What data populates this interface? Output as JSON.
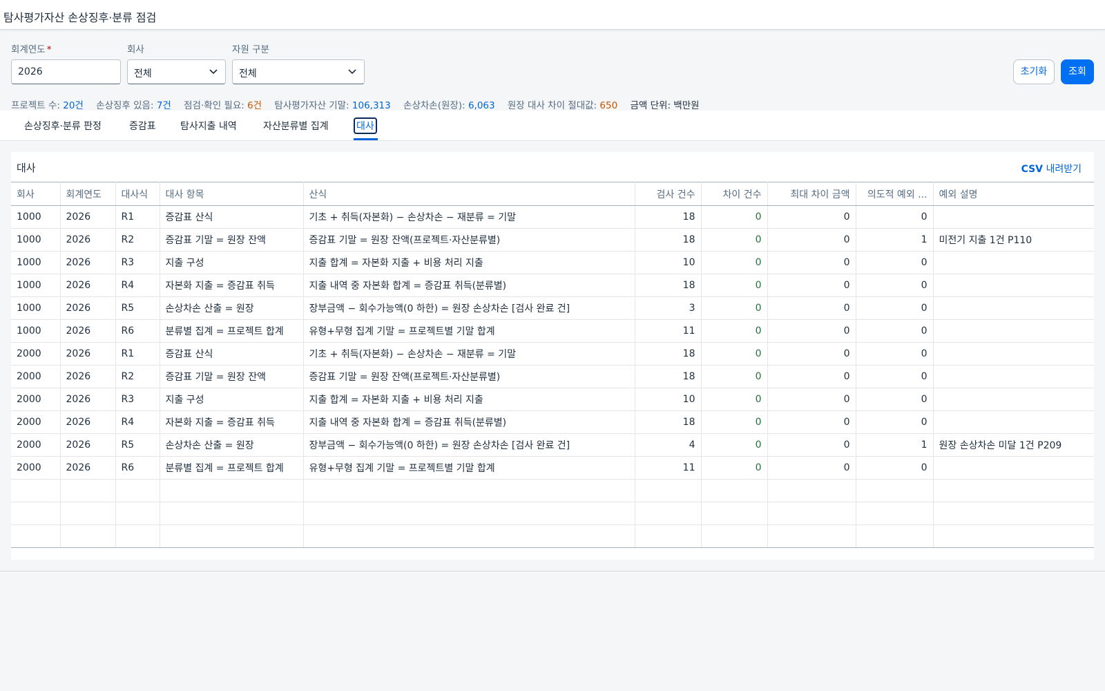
{
  "app": {
    "title": "탐사평가자산 손상징후·분류 점검"
  },
  "filters": {
    "fiscal_year": {
      "label": "회계연도",
      "required_mark": "*",
      "value": "2026"
    },
    "company": {
      "label": "회사",
      "value": "전체"
    },
    "resource_type": {
      "label": "자원 구분",
      "value": "전체"
    },
    "reset_label": "초기화",
    "search_label": "조회"
  },
  "summary": {
    "projects_label": "프로젝트 수:",
    "projects_value": "20건",
    "impairment_label": "손상징후 있음:",
    "impairment_value": "7건",
    "check_label": "점검·확인 필요:",
    "check_value": "6건",
    "ending_label": "탐사평가자산 기말:",
    "ending_value": "106,313",
    "loss_label": "손상차손(원장):",
    "loss_value": "6,063",
    "diff_label": "원장 대사 차이 절대값:",
    "diff_value": "650",
    "unit_label": "금액 단위: 백만원"
  },
  "tabs": [
    {
      "label": "손상징후·분류 판정"
    },
    {
      "label": "증감표"
    },
    {
      "label": "탐사지출 내역"
    },
    {
      "label": "자산분류별 집계"
    },
    {
      "label": "대사"
    }
  ],
  "panel": {
    "title": "대사",
    "csv_prefix": "CSV",
    "csv_suffix": " 내려받기"
  },
  "table": {
    "headers": [
      "회사",
      "회계연도",
      "대사식",
      "대사 항목",
      "산식",
      "검사 건수",
      "차이 건수",
      "최대 차이 금액",
      "의도적 예외 ...",
      "예외 설명"
    ],
    "rows": [
      [
        "1000",
        "2026",
        "R1",
        "증감표 산식",
        "기초 + 취득(자본화) − 손상차손 − 재분류 = 기말",
        "18",
        "0",
        "0",
        "0",
        ""
      ],
      [
        "1000",
        "2026",
        "R2",
        "증감표 기말 = 원장 잔액",
        "증감표 기말 = 원장 잔액(프로젝트·자산분류별)",
        "18",
        "0",
        "0",
        "1",
        "미전기 지출 1건 P110"
      ],
      [
        "1000",
        "2026",
        "R3",
        "지출 구성",
        "지출 합계 = 자본화 지출 + 비용 처리 지출",
        "10",
        "0",
        "0",
        "0",
        ""
      ],
      [
        "1000",
        "2026",
        "R4",
        "자본화 지출 = 증감표 취득",
        "지출 내역 중 자본화 합계 = 증감표 취득(분류별)",
        "18",
        "0",
        "0",
        "0",
        ""
      ],
      [
        "1000",
        "2026",
        "R5",
        "손상차손 산출 = 원장",
        "장부금액 − 회수가능액(0 하한) = 원장 손상차손 [검사 완료 건]",
        "3",
        "0",
        "0",
        "0",
        ""
      ],
      [
        "1000",
        "2026",
        "R6",
        "분류별 집계 = 프로젝트 합계",
        "유형+무형 집계 기말 = 프로젝트별 기말 합계",
        "11",
        "0",
        "0",
        "0",
        ""
      ],
      [
        "2000",
        "2026",
        "R1",
        "증감표 산식",
        "기초 + 취득(자본화) − 손상차손 − 재분류 = 기말",
        "18",
        "0",
        "0",
        "0",
        ""
      ],
      [
        "2000",
        "2026",
        "R2",
        "증감표 기말 = 원장 잔액",
        "증감표 기말 = 원장 잔액(프로젝트·자산분류별)",
        "18",
        "0",
        "0",
        "0",
        ""
      ],
      [
        "2000",
        "2026",
        "R3",
        "지출 구성",
        "지출 합계 = 자본화 지출 + 비용 처리 지출",
        "10",
        "0",
        "0",
        "0",
        ""
      ],
      [
        "2000",
        "2026",
        "R4",
        "자본화 지출 = 증감표 취득",
        "지출 내역 중 자본화 합계 = 증감표 취득(분류별)",
        "18",
        "0",
        "0",
        "0",
        ""
      ],
      [
        "2000",
        "2026",
        "R5",
        "손상차손 산출 = 원장",
        "장부금액 − 회수가능액(0 하한) = 원장 손상차손 [검사 완료 건]",
        "4",
        "0",
        "0",
        "1",
        "원장 손상차손 미달 1건 P209"
      ],
      [
        "2000",
        "2026",
        "R6",
        "분류별 집계 = 프로젝트 합계",
        "유형+무형 집계 기말 = 프로젝트별 기말 합계",
        "11",
        "0",
        "0",
        "0",
        ""
      ]
    ]
  },
  "icons": {
    "dropdown": "chevron-down-icon"
  },
  "colors": {
    "accent": "#0070f2",
    "link": "#0064d9",
    "warning": "#c35500",
    "positive": "#256f3a"
  }
}
